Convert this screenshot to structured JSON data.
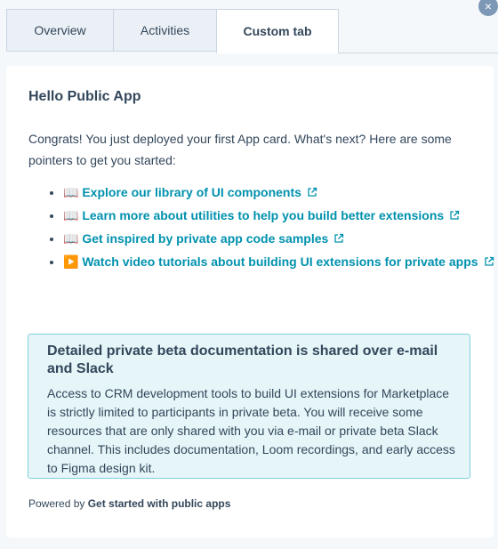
{
  "tabs": [
    {
      "label": "Overview"
    },
    {
      "label": "Activities"
    },
    {
      "label": "Custom tab"
    }
  ],
  "card": {
    "title": "Hello Public App",
    "intro": "Congrats! You just deployed your first App card. What's next? Here are some pointers to get you started:",
    "links": [
      {
        "emoji": "📖",
        "label": "Explore our library of UI components",
        "icon": "external-link-icon"
      },
      {
        "emoji": "📖",
        "label": "Learn more about utilities to help you build better extensions",
        "icon": "external-link-icon"
      },
      {
        "emoji": "📖",
        "label": "Get inspired by private app code samples",
        "icon": "external-link-icon"
      },
      {
        "emoji": "▶️",
        "label": "Watch video tutorials about building UI extensions for private apps",
        "icon": "external-link-icon"
      }
    ],
    "callout": {
      "title": "Detailed private beta documentation is shared over e-mail and Slack",
      "body": "Access to CRM development tools to build UI extensions for Marketplace is strictly limited to participants in private beta. You will receive some resources that are only shared with you via e-mail or private beta Slack channel. This includes documentation, Loom recordings, and early access to Figma design kit."
    },
    "footer": {
      "prefix": "Powered by",
      "link": "Get started with public apps"
    }
  },
  "colors": {
    "link": "#0091ae",
    "callout_bg": "#e5f5f8",
    "callout_border": "#7fd1de",
    "text": "#33475b"
  }
}
